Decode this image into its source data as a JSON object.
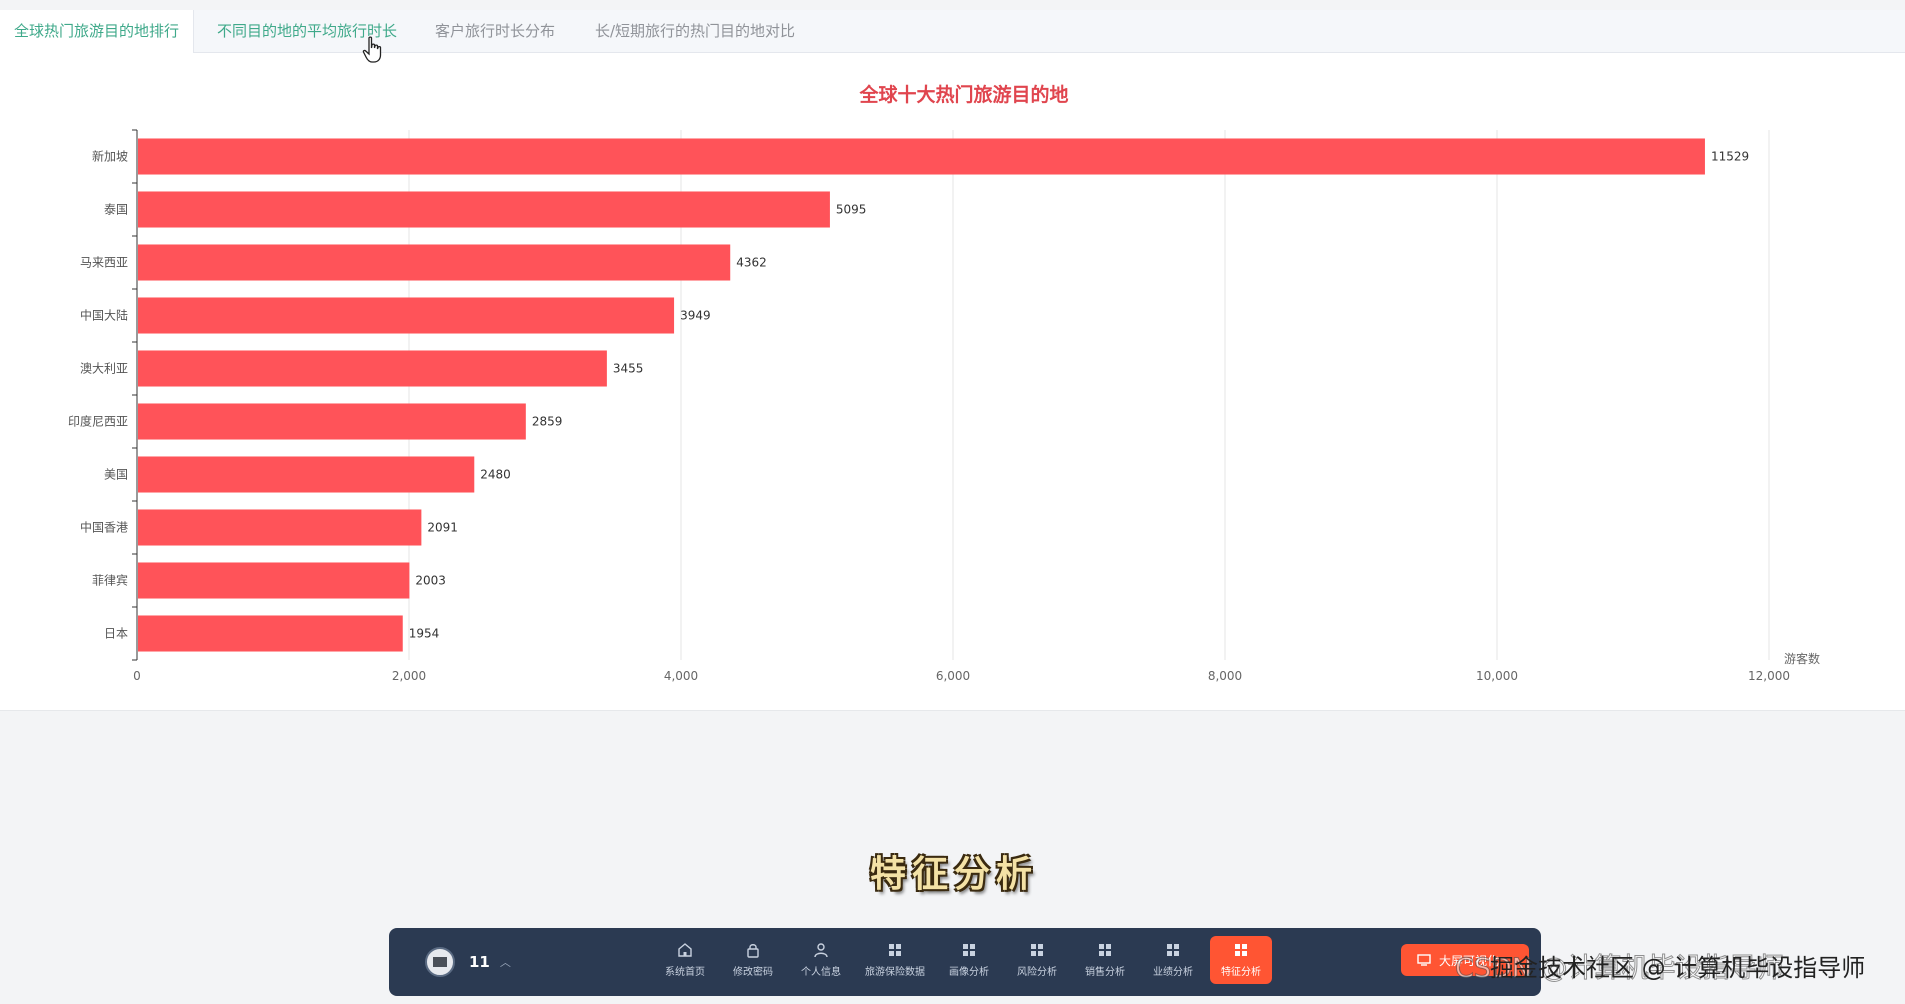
{
  "tabs": [
    {
      "label": "全球热门旅游目的地排行",
      "active": true
    },
    {
      "label": "不同目的地的平均旅行时长",
      "active": false
    },
    {
      "label": "客户旅行时长分布",
      "active": false
    },
    {
      "label": "长/短期旅行的热门目的地对比",
      "active": false
    }
  ],
  "chart_data": {
    "type": "bar",
    "orientation": "horizontal",
    "title": "全球十大热门旅游目的地",
    "xlabel": "游客数",
    "ylabel": "",
    "categories": [
      "新加坡",
      "泰国",
      "马来西亚",
      "中国大陆",
      "澳大利亚",
      "印度尼西亚",
      "美国",
      "中国香港",
      "菲律宾",
      "日本"
    ],
    "values": [
      11529,
      5095,
      4362,
      3949,
      3455,
      2859,
      2480,
      2091,
      2003,
      1954
    ],
    "xlim": [
      0,
      12000
    ],
    "xticks": [
      "0",
      "2,000",
      "4,000",
      "6,000",
      "8,000",
      "10,000",
      "12,000"
    ],
    "bar_color": "#ff5359",
    "grid": true
  },
  "overlay_text": "特征分析",
  "dock": {
    "user_name": "11",
    "items": [
      {
        "label": "系统首页",
        "icon": "home-icon"
      },
      {
        "label": "修改密码",
        "icon": "lock-icon"
      },
      {
        "label": "个人信息",
        "icon": "user-icon"
      },
      {
        "label": "旅游保险数据",
        "icon": "grid-icon"
      },
      {
        "label": "画像分析",
        "icon": "grid-icon"
      },
      {
        "label": "风险分析",
        "icon": "grid-icon"
      },
      {
        "label": "销售分析",
        "icon": "grid-icon"
      },
      {
        "label": "业绩分析",
        "icon": "grid-icon"
      },
      {
        "label": "特征分析",
        "icon": "grid-icon",
        "active": true
      }
    ],
    "right_button": "大屏可视化"
  },
  "watermark": "掘金技术社区 @ 计算机毕设指导师",
  "watermark_bg": "CSDN @计算机毕设指导师",
  "colors": {
    "accent": "#3fa98a",
    "title": "#e0454e",
    "bar": "#ff5359",
    "dock": "#2b3a52",
    "dock_active": "#ff5533"
  }
}
